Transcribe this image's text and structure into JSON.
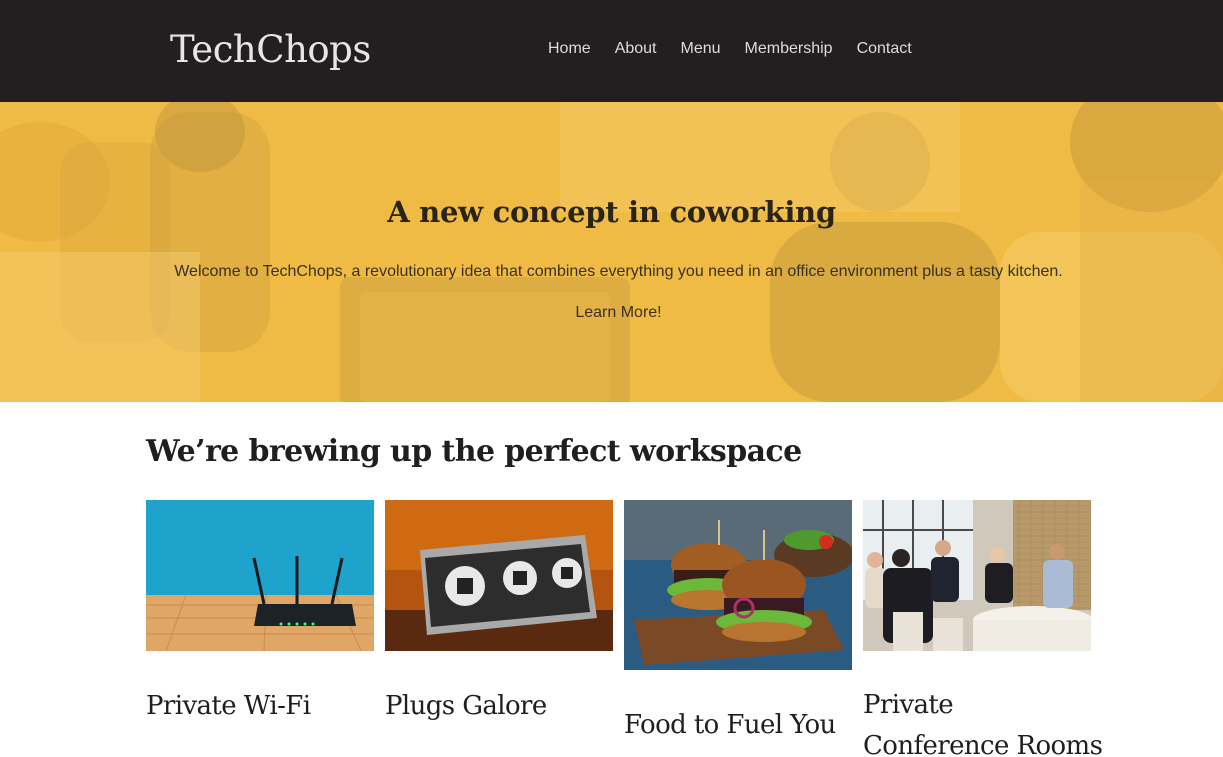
{
  "header": {
    "logo": "TechChops",
    "nav": [
      "Home",
      "About",
      "Menu",
      "Membership",
      "Contact"
    ]
  },
  "hero": {
    "title": "A new concept in coworking",
    "text": "Welcome to TechChops, a revolutionary idea that combines everything you need in an office environment plus a tasty kitchen.",
    "cta": "Learn More!"
  },
  "features": {
    "title": "We’re brewing up the perfect workspace",
    "cards": [
      {
        "title": "Private Wi-Fi",
        "image": "router-photo"
      },
      {
        "title": "Plugs Galore",
        "image": "power-outlets-photo"
      },
      {
        "title": "Food to Fuel You",
        "image": "burgers-photo"
      },
      {
        "title": "Private Conference Rooms",
        "image": "meeting-photo"
      }
    ]
  },
  "colors": {
    "header_bg": "#231f20",
    "hero_accent": "#f6be38"
  }
}
